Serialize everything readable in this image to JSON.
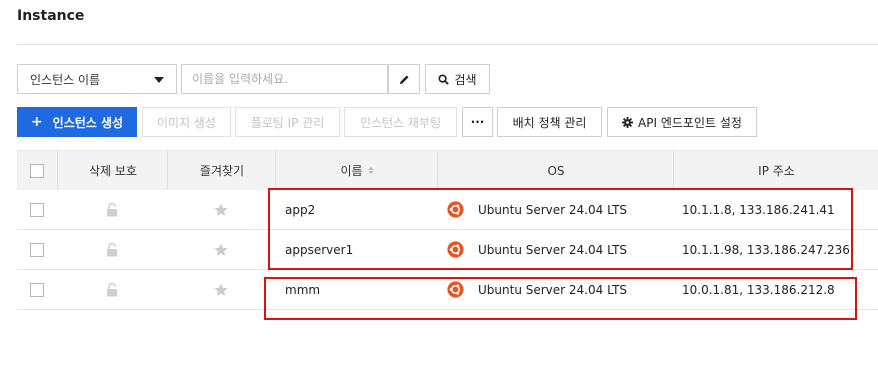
{
  "page": {
    "title": "Instance"
  },
  "toolbar": {
    "filter_select": "인스턴스 이름",
    "search_placeholder": "이름을 입력하세요.",
    "search_button": "검색"
  },
  "actions": {
    "create": "인스턴스 생성",
    "create_plus": "+",
    "create_image": "이미지 생성",
    "floating_ip": "플로팅 IP 관리",
    "reboot": "인스턴스 재부팅",
    "more": "···",
    "placement_policy": "배치 정책 관리",
    "api_endpoint": "API 엔드포인트 설정"
  },
  "table": {
    "headers": [
      "삭제 보호",
      "즐겨찾기",
      "이름",
      "OS",
      "IP 주소"
    ],
    "rows": [
      {
        "name": "app2",
        "os": "Ubuntu Server 24.04 LTS",
        "ip": "10.1.1.8, 133.186.241.41"
      },
      {
        "name": "appserver1",
        "os": "Ubuntu Server 24.04 LTS",
        "ip": "10.1.1.98, 133.186.247.236"
      },
      {
        "name": "mmm",
        "os": "Ubuntu Server 24.04 LTS",
        "ip": "10.0.1.81, 133.186.212.8"
      }
    ]
  },
  "colors": {
    "primary": "#1f6ae0",
    "ubuntu": "#e95420",
    "highlight": "#dd1111"
  }
}
